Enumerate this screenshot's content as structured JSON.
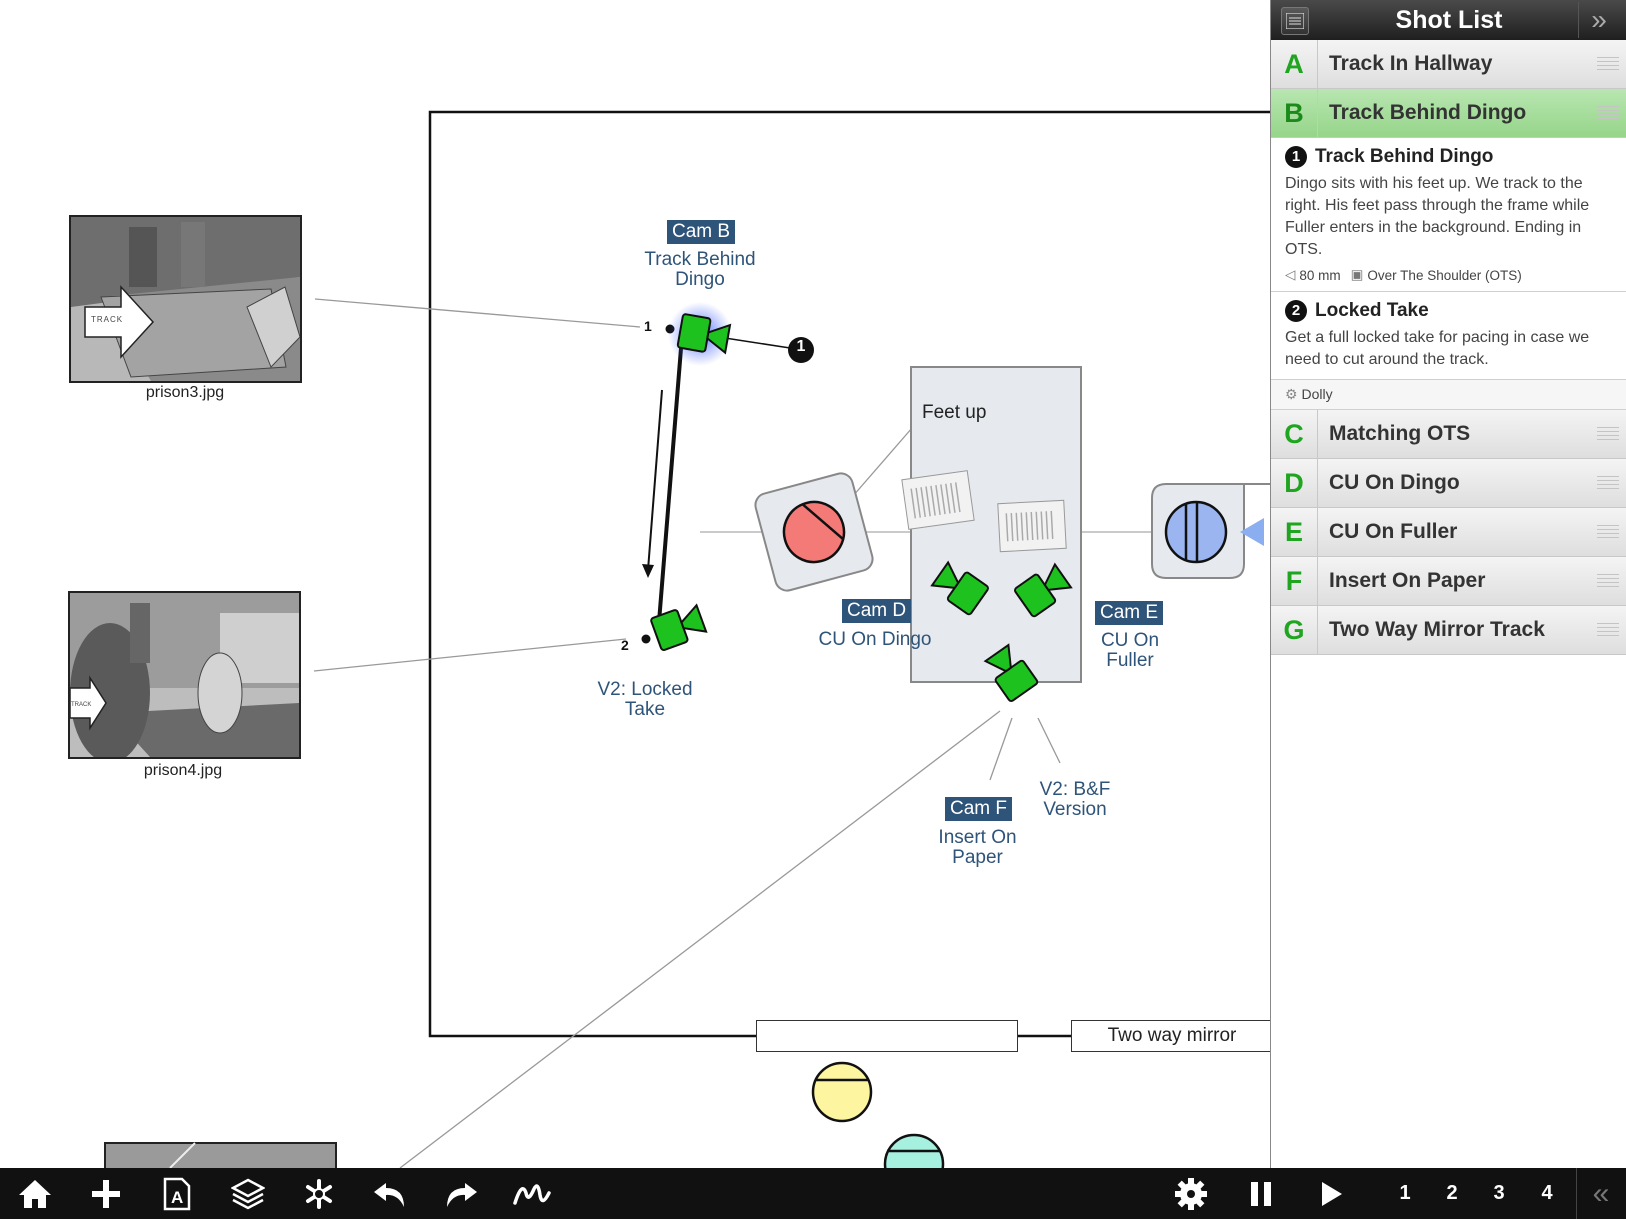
{
  "canvas": {
    "thumbnails": [
      {
        "caption": "prison3.jpg",
        "arrow_text": "TRACK"
      },
      {
        "caption": "prison4.jpg",
        "arrow_text": "TRACK"
      }
    ],
    "cameras": {
      "cam_b": {
        "badge": "Cam B",
        "label": "Track Behind Dingo"
      },
      "cam_b_v2": {
        "label": "V2: Locked Take"
      },
      "cam_d": {
        "badge": "Cam D",
        "label": "CU On Dingo"
      },
      "cam_e": {
        "badge": "Cam E",
        "label": "CU On Fuller"
      },
      "cam_f": {
        "badge": "Cam F",
        "label": "Insert On Paper"
      },
      "cam_f_v2": {
        "label": "V2: B&F Version"
      }
    },
    "path_markers": {
      "point1": "1",
      "point2": "2",
      "setup_marker": "1"
    },
    "table_note": "Feet up",
    "mirror_label": "Two way mirror"
  },
  "sidebar": {
    "title": "Shot List",
    "shots": [
      {
        "letter": "A",
        "title": "Track In Hallway",
        "active": false
      },
      {
        "letter": "B",
        "title": "Track Behind Dingo",
        "active": true
      },
      {
        "letter": "C",
        "title": "Matching OTS",
        "active": false
      },
      {
        "letter": "D",
        "title": "CU On Dingo",
        "active": false
      },
      {
        "letter": "E",
        "title": "CU On Fuller",
        "active": false
      },
      {
        "letter": "F",
        "title": "Insert On Paper",
        "active": false
      },
      {
        "letter": "G",
        "title": "Two Way Mirror Track",
        "active": false
      }
    ],
    "setups": [
      {
        "num": "1",
        "title": "Track Behind Dingo",
        "desc": "Dingo sits with his feet up. We track to the right. His feet pass through the frame while Fuller enters in the background. Ending in OTS.",
        "lens": "80 mm",
        "framing": "Over The Shoulder (OTS)"
      },
      {
        "num": "2",
        "title": "Locked Take",
        "desc": "Get a full locked take for pacing in case we need to cut around the track."
      }
    ],
    "equipment": "Dolly"
  },
  "toolbar": {
    "left_icons": [
      "home-icon",
      "add-icon",
      "text-icon",
      "layers-icon",
      "asterisk-icon",
      "undo-icon",
      "redo-icon",
      "draw-icon"
    ],
    "right_icons": [
      "settings-icon",
      "pause-icon",
      "play-icon"
    ],
    "pages": [
      "1",
      "2",
      "3",
      "4"
    ],
    "colors": {
      "accent": "#1fa51f",
      "cam_badge": "#2f5479",
      "camera_green": "#1ec21e"
    }
  }
}
